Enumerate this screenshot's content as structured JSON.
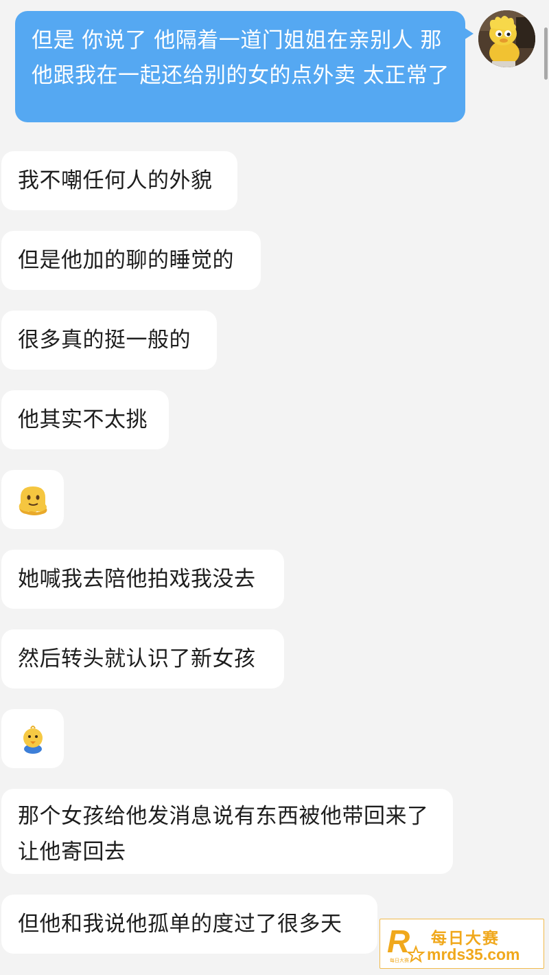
{
  "conversation": {
    "sent_message": "但是 你说了 他隔着一道门姐姐在亲别人 那他跟我在一起还给别的女的点外卖 太正常了",
    "received_messages": [
      "我不嘲任何人的外貌",
      "但是他加的聊的睡觉的",
      "很多真的挺一般的",
      "他其实不太挑",
      "她喊我去陪他拍戏我没去",
      "然后转头就认识了新女孩",
      "那个女孩给他发消息说有东西被他带回来了 让他寄回去",
      "但他和我说他孤单的度过了很多天"
    ],
    "stickers": [
      "melting-face-emoji-icon",
      "yellow-chick-emoji-icon"
    ]
  },
  "watermark": {
    "title": "每日大赛",
    "url": "mrds35.com",
    "logo_letter": "R",
    "logo_small_text": "每日大赛"
  },
  "colors": {
    "sent_bubble": "#55a8f2",
    "received_bubble": "#ffffff",
    "background": "#f3f3f3",
    "watermark": "#f0a81c"
  }
}
